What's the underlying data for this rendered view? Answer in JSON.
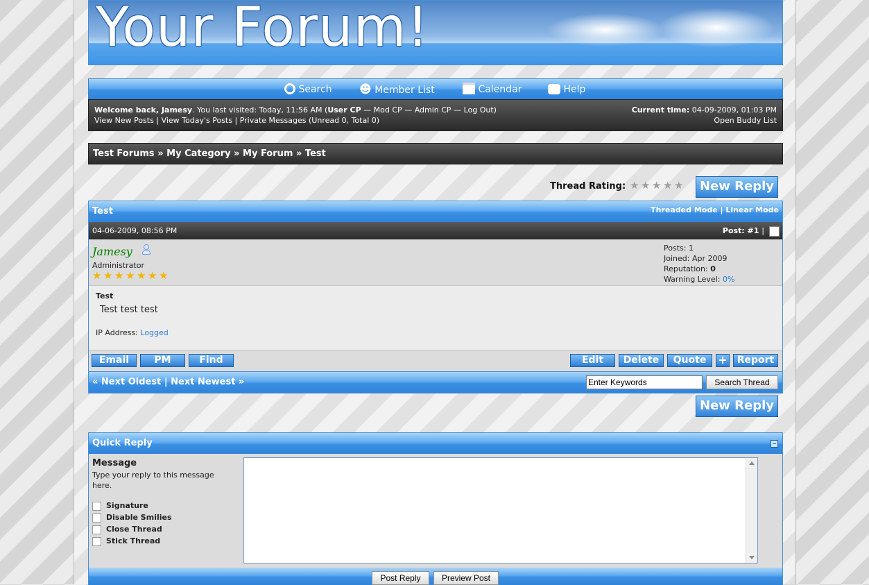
{
  "header": {
    "logo_text": "Your Forum!"
  },
  "nav": {
    "items": [
      {
        "label": "Search"
      },
      {
        "label": "Member List"
      },
      {
        "label": "Calendar"
      },
      {
        "label": "Help"
      }
    ]
  },
  "welcome": {
    "greeting": "Welcome back, Jamesy",
    "last_visited": ". You last visited: Today, 11:56 AM (",
    "user_cp": "User CP",
    "mod_cp": "Mod CP",
    "admin_cp": "Admin CP",
    "log_out": "Log Out",
    "dash": "—",
    "paren_close": ")",
    "view_new_posts": "View New Posts",
    "view_todays_posts": "View Today's Posts",
    "private_messages": "Private Messages",
    "pm_counts": "(Unread 0, Total 0)",
    "separator": "|",
    "current_time_label": "Current time:",
    "current_time_value": "04-09-2009, 01:03 PM",
    "buddy_list": "Open Buddy List"
  },
  "breadcrumb": {
    "items": [
      "Test Forums",
      "My Category",
      "My Forum",
      "Test"
    ],
    "sep": "»"
  },
  "thread": {
    "rating_label": "Thread Rating:",
    "rating_value": 0,
    "rating_max": 5,
    "new_reply_label": "New Reply",
    "title": "Test",
    "threaded_mode": "Threaded Mode",
    "linear_mode": "Linear Mode",
    "mode_sep": "|"
  },
  "post": {
    "date": "04-06-2009, 08:56 PM",
    "post_number": "Post: #1",
    "post_sep": "|",
    "author": "Jamesy",
    "usertitle": "Administrator",
    "stars": 7,
    "stats": {
      "posts_label": "Posts:",
      "posts_value": "1",
      "joined_label": "Joined:",
      "joined_value": "Apr 2009",
      "reputation_label": "Reputation:",
      "reputation_value": "0",
      "warning_label": "Warning Level:",
      "warning_value": "0%"
    },
    "subject": "Test",
    "body": "Test test test",
    "ip_label": "IP Address:",
    "ip_value": "Logged",
    "buttons_left": [
      "Email",
      "PM",
      "Find"
    ],
    "buttons_right": {
      "edit": "Edit",
      "delete": "Delete",
      "quote": "Quote",
      "plus": "+",
      "report": "Report"
    }
  },
  "thread_nav": {
    "next_oldest": "« Next Oldest",
    "sep": "|",
    "next_newest": "Next Newest »",
    "search_placeholder": "Enter Keywords",
    "search_button": "Search Thread"
  },
  "quick_reply": {
    "title": "Quick Reply",
    "message_label": "Message",
    "message_help": "Type your reply to this message here.",
    "options": [
      "Signature",
      "Disable Smilies",
      "Close Thread",
      "Stick Thread"
    ],
    "post_button": "Post Reply",
    "preview_button": "Preview Post"
  },
  "colors": {
    "author": "#008000",
    "link_blue": "#2a7ad0",
    "accent": "#3b90e3"
  }
}
